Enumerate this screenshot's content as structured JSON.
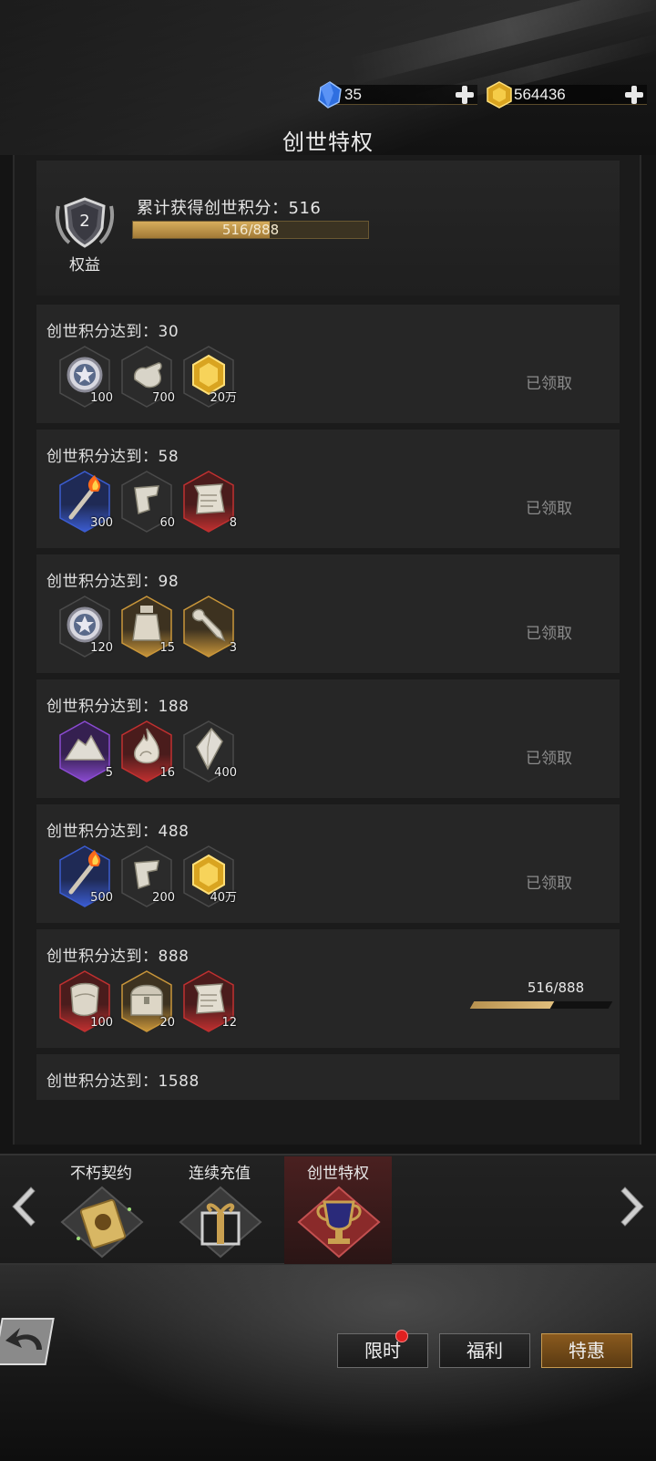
{
  "currencies": [
    {
      "name": "gem",
      "icon": "blue-crystal-icon",
      "value": "35",
      "color": "#3f7fe8"
    },
    {
      "name": "gold",
      "icon": "gold-crystal-icon",
      "value": "564436",
      "color": "#e3b12a"
    }
  ],
  "title": "创世特权",
  "header": {
    "badge_level": "2",
    "badge_label": "权益",
    "total_label": "累计获得创世积分：516",
    "progress_text": "516/888",
    "progress_value": 516,
    "progress_max": 888
  },
  "rows": [
    {
      "title": "创世积分达到：30",
      "status": "已领取",
      "items": [
        {
          "icon": "silver-coin-icon",
          "qty": "100",
          "frame": "plain"
        },
        {
          "icon": "hand-glove-icon",
          "qty": "700",
          "frame": "plain"
        },
        {
          "icon": "gold-crystal-icon",
          "qty": "20万",
          "frame": "plain"
        }
      ]
    },
    {
      "title": "创世积分达到：58",
      "status": "已领取",
      "items": [
        {
          "icon": "torch-icon",
          "qty": "300",
          "frame": "blue"
        },
        {
          "icon": "fragment-icon",
          "qty": "60",
          "frame": "plain"
        },
        {
          "icon": "scroll-icon",
          "qty": "8",
          "frame": "red"
        }
      ]
    },
    {
      "title": "创世积分达到：98",
      "status": "已领取",
      "items": [
        {
          "icon": "silver-coin-icon",
          "qty": "120",
          "frame": "plain"
        },
        {
          "icon": "jar-icon",
          "qty": "15",
          "frame": "gold"
        },
        {
          "icon": "key-icon",
          "qty": "3",
          "frame": "gold"
        }
      ]
    },
    {
      "title": "创世积分达到：188",
      "status": "已领取",
      "items": [
        {
          "icon": "ore-pile-icon",
          "qty": "5",
          "frame": "purple"
        },
        {
          "icon": "flame-icon",
          "qty": "16",
          "frame": "red"
        },
        {
          "icon": "diamond-shard-icon",
          "qty": "400",
          "frame": "plain"
        }
      ]
    },
    {
      "title": "创世积分达到：488",
      "status": "已领取",
      "items": [
        {
          "icon": "torch-icon",
          "qty": "500",
          "frame": "blue"
        },
        {
          "icon": "fragment-icon",
          "qty": "200",
          "frame": "plain"
        },
        {
          "icon": "gold-crystal-icon",
          "qty": "40万",
          "frame": "plain"
        }
      ]
    },
    {
      "title": "创世积分达到：888",
      "status": "",
      "progress_text": "516/888",
      "progress_value": 516,
      "progress_max": 888,
      "items": [
        {
          "icon": "cloth-bundle-icon",
          "qty": "100",
          "frame": "red"
        },
        {
          "icon": "treasure-chest-icon",
          "qty": "20",
          "frame": "gold"
        },
        {
          "icon": "scroll-icon",
          "qty": "12",
          "frame": "red"
        }
      ]
    },
    {
      "title": "创世积分达到：1588",
      "status": "",
      "items": []
    }
  ],
  "tabs": [
    {
      "label": "不朽契约",
      "icon": "contract-scroll-icon",
      "active": false
    },
    {
      "label": "连续充值",
      "icon": "gift-box-icon",
      "active": false
    },
    {
      "label": "创世特权",
      "icon": "trophy-icon",
      "active": true
    }
  ],
  "nav_buttons": [
    {
      "label": "限时",
      "active": false,
      "has_dot": true
    },
    {
      "label": "福利",
      "active": false,
      "has_dot": false
    },
    {
      "label": "特惠",
      "active": true,
      "has_dot": false
    }
  ]
}
